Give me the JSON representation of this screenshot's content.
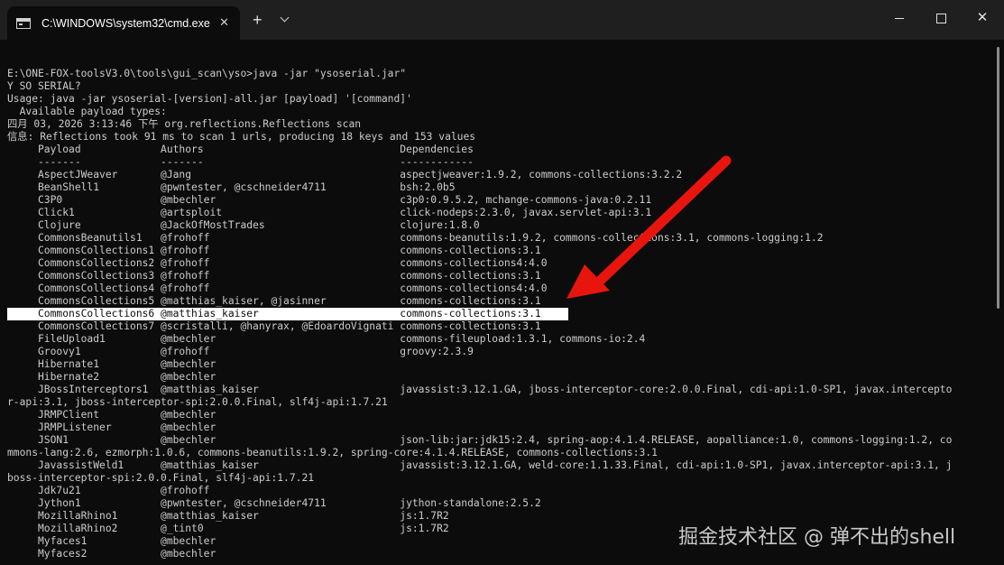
{
  "window": {
    "tab_title": "C:\\WINDOWS\\system32\\cmd.exe",
    "tab_close": "✕",
    "new_tab": "+",
    "close_glyph": "✕"
  },
  "console": {
    "lines": [
      "",
      "E:\\ONE-FOX-toolsV3.0\\tools\\gui_scan\\yso>java -jar \"ysoserial.jar\"",
      "Y SO SERIAL?",
      "Usage: java -jar ysoserial-[version]-all.jar [payload] '[command]'",
      "  Available payload types:",
      "四月 03, 2026 3:13:46 下午 org.reflections.Reflections scan",
      "信息: Reflections took 91 ms to scan 1 urls, producing 18 keys and 153 values",
      "     Payload             Authors                                Dependencies",
      "     -------             -------                                ------------",
      "     AspectJWeaver       @Jang                                  aspectjweaver:1.9.2, commons-collections:3.2.2",
      "     BeanShell1          @pwntester, @cschneider4711            bsh:2.0b5",
      "     C3P0                @mbechler                              c3p0:0.9.5.2, mchange-commons-java:0.2.11",
      "     Click1              @artsploit                             click-nodeps:2.3.0, javax.servlet-api:3.1",
      "     Clojure             @JackOfMostTrades                      clojure:1.8.0",
      "     CommonsBeanutils1   @frohoff                               commons-beanutils:1.9.2, commons-collections:3.1, commons-logging:1.2",
      "     CommonsCollections1 @frohoff                               commons-collections:3.1",
      "     CommonsCollections2 @frohoff                               commons-collections4:4.0",
      "     CommonsCollections3 @frohoff                               commons-collections:3.1",
      "     CommonsCollections4 @frohoff                               commons-collections4:4.0",
      "     CommonsCollections5 @matthias_kaiser, @jasinner            commons-collections:3.1",
      "     CommonsCollections6 @matthias_kaiser                       commons-collections:3.1",
      "     CommonsCollections7 @scristalli, @hanyrax, @EdoardoVignati commons-collections:3.1",
      "     FileUpload1         @mbechler                              commons-fileupload:1.3.1, commons-io:2.4",
      "     Groovy1             @frohoff                               groovy:2.3.9",
      "     Hibernate1          @mbechler",
      "     Hibernate2          @mbechler",
      "     JBossInterceptors1  @matthias_kaiser                       javassist:3.12.1.GA, jboss-interceptor-core:2.0.0.Final, cdi-api:1.0-SP1, javax.intercepto",
      "r-api:3.1, jboss-interceptor-spi:2.0.0.Final, slf4j-api:1.7.21",
      "     JRMPClient          @mbechler",
      "     JRMPListener        @mbechler",
      "     JSON1               @mbechler                              json-lib:jar:jdk15:2.4, spring-aop:4.1.4.RELEASE, aopalliance:1.0, commons-logging:1.2, co",
      "mmons-lang:2.6, ezmorph:1.0.6, commons-beanutils:1.9.2, spring-core:4.1.4.RELEASE, commons-collections:3.1",
      "     JavassistWeld1      @matthias_kaiser                       javassist:3.12.1.GA, weld-core:1.1.33.Final, cdi-api:1.0-SP1, javax.interceptor-api:3.1, j",
      "boss-interceptor-spi:2.0.0.Final, slf4j-api:1.7.21",
      "     Jdk7u21             @frohoff",
      "     Jython1             @pwntester, @cschneider4711            jython-standalone:2.5.2",
      "     MozillaRhino1       @matthias_kaiser                       js:1.7R2",
      "     MozillaRhino2       @_tint0                                js:1.7R2",
      "     Myfaces1            @mbechler",
      "     Myfaces2            @mbechler"
    ],
    "highlighted_line_index": 20
  },
  "annotation": {
    "arrow_color": "#e8150f"
  },
  "watermark": "掘金技术社区 @ 弹不出的shell"
}
